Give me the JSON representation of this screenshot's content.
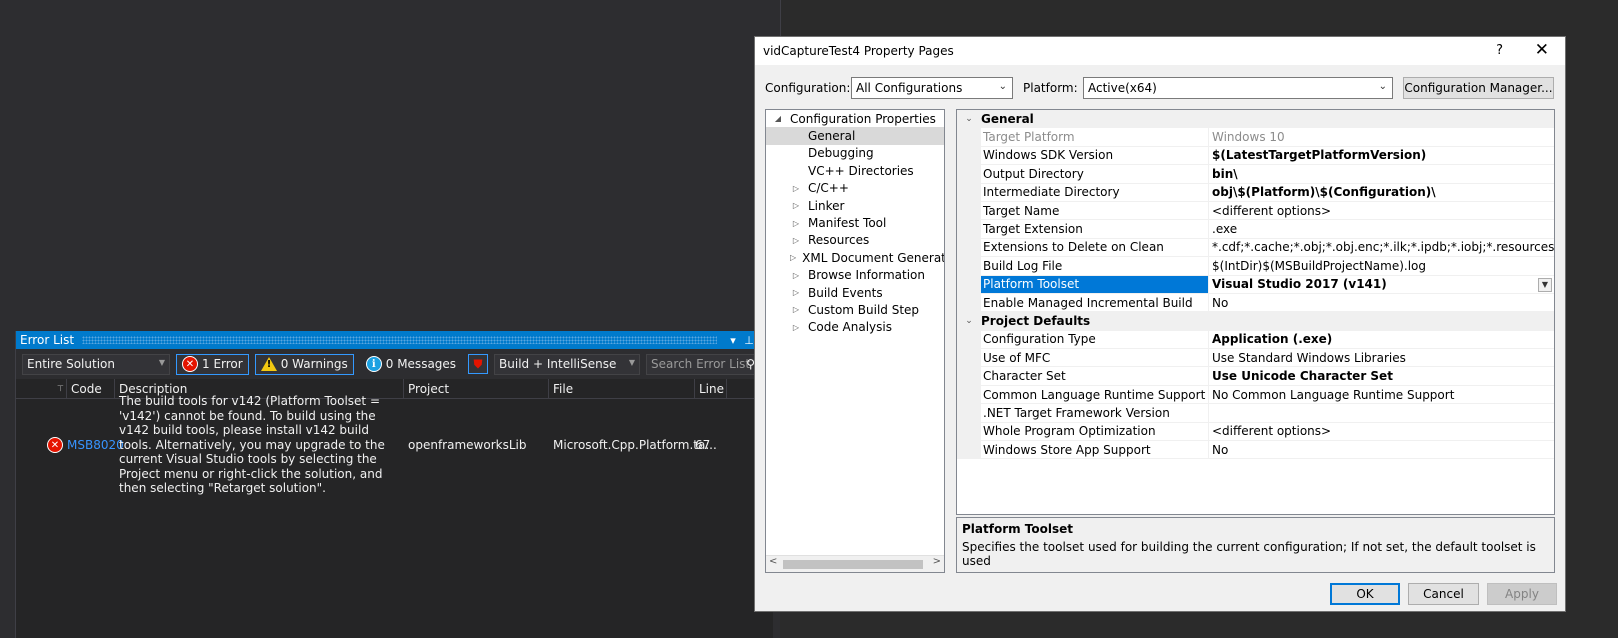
{
  "error_list": {
    "title": "Error List",
    "scope": "Entire Solution",
    "errors_label": "1 Error",
    "warnings_label": "0 Warnings",
    "messages_label": "0 Messages",
    "build_filter": "Build + IntelliSense",
    "search_placeholder": "Search Error List",
    "columns": [
      "Code",
      "Description",
      "Project",
      "File",
      "Line"
    ],
    "rows": [
      {
        "code": "MSB8020",
        "description": "The build tools for v142 (Platform Toolset = 'v142') cannot be found. To build using the v142 build tools, please install v142 build tools.  Alternatively, you may upgrade to the current Visual Studio tools by selecting the Project menu or right-click the solution, and then selecting \"Retarget solution\".",
        "project": "openframeworksLib",
        "file": "Microsoft.Cpp.Platform.ta...",
        "line": "67"
      }
    ]
  },
  "dialog": {
    "title": "vidCaptureTest4 Property Pages",
    "help": "?",
    "close": "✕",
    "configuration_label": "Configuration:",
    "configuration_value": "All Configurations",
    "platform_label": "Platform:",
    "platform_value": "Active(x64)",
    "config_manager_label": "Configuration Manager...",
    "tree": {
      "root": "Configuration Properties",
      "items": [
        {
          "label": "General",
          "expandable": false
        },
        {
          "label": "Debugging",
          "expandable": false
        },
        {
          "label": "VC++ Directories",
          "expandable": false
        },
        {
          "label": "C/C++",
          "expandable": true
        },
        {
          "label": "Linker",
          "expandable": true
        },
        {
          "label": "Manifest Tool",
          "expandable": true
        },
        {
          "label": "Resources",
          "expandable": true
        },
        {
          "label": "XML Document Generator",
          "expandable": true
        },
        {
          "label": "Browse Information",
          "expandable": true
        },
        {
          "label": "Build Events",
          "expandable": true
        },
        {
          "label": "Custom Build Step",
          "expandable": true
        },
        {
          "label": "Code Analysis",
          "expandable": true
        }
      ]
    },
    "grid": {
      "general_title": "General",
      "general_rows": [
        {
          "name": "Target Platform",
          "value": "Windows 10"
        },
        {
          "name": "Windows SDK Version",
          "value": "$(LatestTargetPlatformVersion)"
        },
        {
          "name": "Output Directory",
          "value": "bin\\"
        },
        {
          "name": "Intermediate Directory",
          "value": "obj\\$(Platform)\\$(Configuration)\\"
        },
        {
          "name": "Target Name",
          "value": "<different options>"
        },
        {
          "name": "Target Extension",
          "value": ".exe"
        },
        {
          "name": "Extensions to Delete on Clean",
          "value": "*.cdf;*.cache;*.obj;*.obj.enc;*.ilk;*.ipdb;*.iobj;*.resources;*.tlb;*.tli;*.t"
        },
        {
          "name": "Build Log File",
          "value": "$(IntDir)$(MSBuildProjectName).log"
        },
        {
          "name": "Platform Toolset",
          "value": "Visual Studio 2017 (v141)"
        },
        {
          "name": "Enable Managed Incremental Build",
          "value": "No"
        }
      ],
      "defaults_title": "Project Defaults",
      "defaults_rows": [
        {
          "name": "Configuration Type",
          "value": "Application (.exe)"
        },
        {
          "name": "Use of MFC",
          "value": "Use Standard Windows Libraries"
        },
        {
          "name": "Character Set",
          "value": "Use Unicode Character Set"
        },
        {
          "name": "Common Language Runtime Support",
          "value": "No Common Language Runtime Support"
        },
        {
          "name": ".NET Target Framework Version",
          "value": ""
        },
        {
          "name": "Whole Program Optimization",
          "value": "<different options>"
        },
        {
          "name": "Windows Store App Support",
          "value": "No"
        }
      ]
    },
    "description": {
      "title": "Platform Toolset",
      "text": "Specifies the toolset used for building the current configuration; If not set, the default toolset is used"
    },
    "ok_label": "OK",
    "cancel_label": "Cancel",
    "apply_label": "Apply"
  },
  "colors": {
    "accent": "#007acc",
    "selection": "#0078d7",
    "error": "#e51400",
    "warning": "#f2c811",
    "link": "#3794ff"
  }
}
